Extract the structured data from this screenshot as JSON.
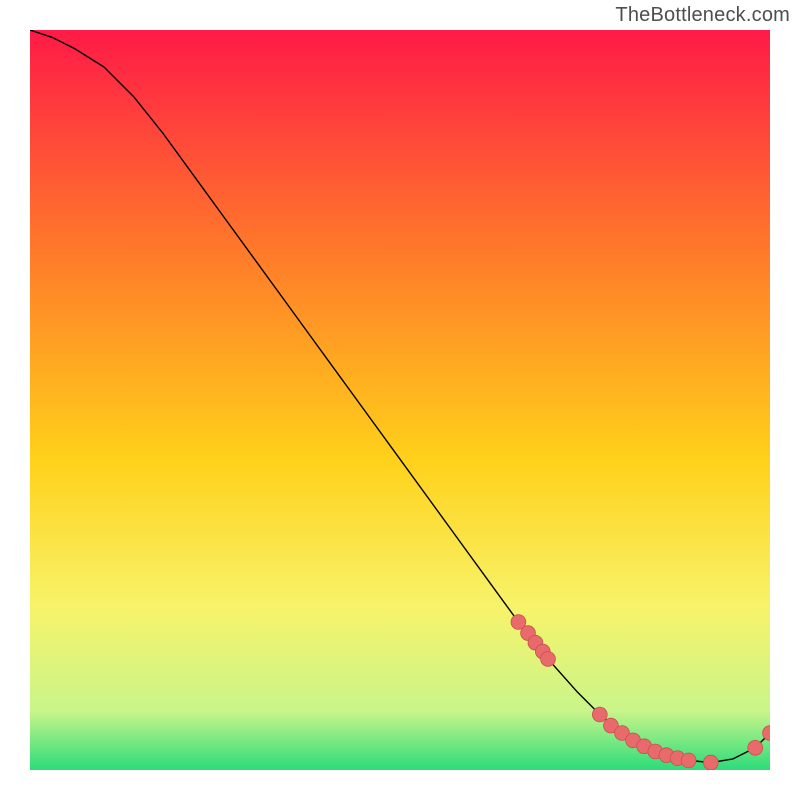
{
  "attribution": "TheBottleneck.com",
  "chart_data": {
    "type": "line",
    "title": "",
    "xlabel": "",
    "ylabel": "",
    "xlim": [
      0,
      100
    ],
    "ylim": [
      0,
      100
    ],
    "grid": false,
    "legend": false,
    "background_gradient": {
      "top": "#ff1a47",
      "upper_mid": "#ff7a2a",
      "mid": "#ffd11a",
      "lower_mid": "#f7f36a",
      "near_bottom": "#c9f58a",
      "bottom": "#2bdc7a"
    },
    "series": [
      {
        "name": "bottleneck-curve",
        "x": [
          0,
          3,
          6,
          10,
          14,
          18,
          22,
          26,
          30,
          34,
          38,
          42,
          46,
          50,
          54,
          58,
          62,
          66,
          70,
          74,
          77,
          80,
          83,
          86,
          89,
          92,
          95,
          98,
          100
        ],
        "y": [
          100,
          99,
          97.5,
          95,
          91,
          86,
          80.5,
          75,
          69.5,
          64,
          58.5,
          53,
          47.5,
          42,
          36.5,
          31,
          25.5,
          20,
          15,
          10.5,
          7.5,
          5,
          3.2,
          2,
          1.3,
          1,
          1.5,
          3,
          5
        ],
        "markers": {
          "x": [
            66,
            67.3,
            68.3,
            69.3,
            70,
            77,
            78.5,
            80,
            81.5,
            83,
            84.5,
            86,
            87.5,
            89,
            92,
            98,
            100
          ],
          "y": [
            20,
            18.5,
            17.2,
            16,
            15,
            7.5,
            6,
            5,
            4,
            3.2,
            2.5,
            2,
            1.6,
            1.3,
            1,
            3,
            5
          ]
        }
      }
    ]
  }
}
